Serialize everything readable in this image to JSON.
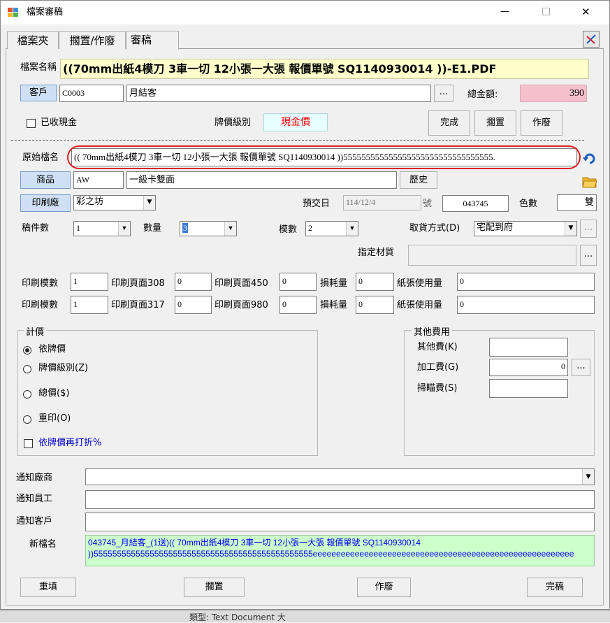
{
  "window": {
    "title": "檔案審稿",
    "minimize_glyph": "—",
    "maximize_glyph": "□",
    "close_glyph": "✕"
  },
  "tabs": [
    "檔案夾",
    "擱置/作廢",
    "審稿"
  ],
  "file_name_label": "檔案名稱",
  "file_name_value": "((70mm出紙4模刀 3車一切 12小張一大張 報價單號 SQ1140930014 ))-E1.PDF",
  "customer": {
    "button_label": "客戶",
    "code": "C0003",
    "name": "月結客",
    "browse_label": "...",
    "total_label": "總金額:",
    "total_value": "390"
  },
  "cash_received_label": "已收現金",
  "price_level_label": "牌價級別",
  "price_level_value": "現金價",
  "action_buttons": {
    "complete": "完成",
    "hold": "擱置",
    "void": "作廢"
  },
  "original_name_label": "原始檔名",
  "original_name_value": "(( 70mm出紙4模刀 3車一切 12小張一大張 報價單號 SQ1140930014 ))555555555555555555555555555555555.",
  "product": {
    "button_label": "商品",
    "code": "AW",
    "name": "一級卡雙面",
    "history_label": "歷史"
  },
  "printer": {
    "button_label": "印刷廠",
    "value": "彩之坊",
    "due_label": "預交日",
    "due_value": "114/12/4",
    "number_label": "號",
    "number_value": "043745",
    "color_label": "色數",
    "color_value": "雙"
  },
  "drafts": {
    "count_label": "稿件數",
    "count_value": "1",
    "qty_label": "數量",
    "qty_value": "3",
    "mold_label": "模數",
    "mold_value": "2",
    "pickup_label": "取貨方式(D)",
    "pickup_value": "宅配到府",
    "browse_label": "..."
  },
  "material": {
    "label": "指定材質",
    "value": "",
    "browse_label": "..."
  },
  "print_rows": [
    {
      "mold_label": "印刷模數",
      "mold_value": "1",
      "page_a_label": "印刷頁面308",
      "page_a_value": "0",
      "page_b_label": "印刷頁面450",
      "page_b_value": "0",
      "loss_label": "損耗量",
      "loss_value": "0",
      "paper_label": "紙張使用量",
      "paper_value": "0"
    },
    {
      "mold_label": "印刷模數",
      "mold_value": "1",
      "page_a_label": "印刷頁面317",
      "page_a_value": "0",
      "page_b_label": "印刷頁面980",
      "page_b_value": "0",
      "loss_label": "損耗量",
      "loss_value": "0",
      "paper_label": "紙張使用量",
      "paper_value": "0"
    }
  ],
  "pricing": {
    "title": "計價",
    "options": [
      "依牌價",
      "牌價級別(Z)",
      "總價($)",
      "重印(O)"
    ],
    "discount_label": "依牌價再打折%"
  },
  "other_fees": {
    "title": "其他費用",
    "other_label": "其他費(K)",
    "other_value": "",
    "process_label": "加工費(G)",
    "process_value": "0",
    "process_browse": "...",
    "scan_label": "掃瞄費(S)",
    "scan_value": ""
  },
  "notify": {
    "vendor_label": "通知廠商",
    "vendor_value": "",
    "staff_label": "通知員工",
    "staff_value": "",
    "customer_label": "通知客戶",
    "customer_value": ""
  },
  "new_name": {
    "label": "新檔名",
    "line1": "043745_月結客_(1送)(( 70mm出紙4模刀 3車一切 12小張一大張 報價單號 SQ1140930014",
    "line2": "))55555555555555555555555555555555555555555555555eeeeeeeeeeeeeeeeeeeeeeeeeeeeeeeeeeeeeeeeeeeeeeeeeeeeeeee"
  },
  "bottom_buttons": {
    "refill": "重填",
    "hold": "擱置",
    "void": "作廢",
    "finalize": "完稿"
  },
  "taskbar_text": "類型: Text Document 大",
  "colors": {
    "file_name_bg": "#ffffcc",
    "total_bg": "#f5c0cc",
    "price_level_bg": "#e8ffff",
    "price_level_text": "#ff0000",
    "new_name_bg": "#ccffcc",
    "new_name_text": "#0000ff",
    "highlight_ring": "#e02020",
    "discount_text": "#0000cc"
  }
}
